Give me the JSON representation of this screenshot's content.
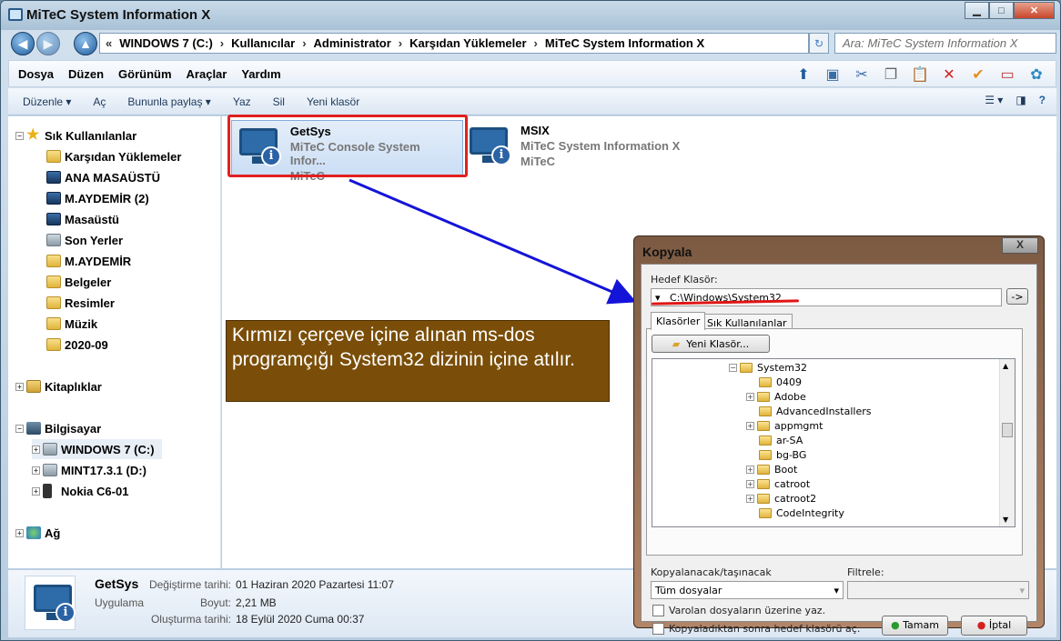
{
  "window": {
    "title": "MiTeC System Information X"
  },
  "address": {
    "crumbs": [
      "WINDOWS 7 (C:)",
      "Kullanıcılar",
      "Administrator",
      "Karşıdan Yüklemeler",
      "MiTeC System Information X"
    ],
    "search_placeholder": "Ara: MiTeC System Information X"
  },
  "menu": [
    "Dosya",
    "Düzen",
    "Görünüm",
    "Araçlar",
    "Yardım"
  ],
  "commands": [
    "Düzenle ▾",
    "Aç",
    "Bununla paylaş ▾",
    "Yaz",
    "Sil",
    "Yeni klasör"
  ],
  "nav": {
    "favorites": "Sık Kullanılanlar",
    "fav_items": [
      "Karşıdan Yüklemeler",
      "ANA MASAÜSTÜ",
      "M.AYDEMİR (2)",
      "Masaüstü",
      "Son Yerler",
      "M.AYDEMİR",
      "Belgeler",
      "Resimler",
      "Müzik",
      "2020-09"
    ],
    "libraries": "Kitaplıklar",
    "computer": "Bilgisayar",
    "drives": [
      "WINDOWS 7 (C:)",
      "MINT17.3.1 (D:)",
      "Nokia C6-01"
    ],
    "network": "Ağ"
  },
  "files": [
    {
      "name": "GetSys",
      "desc": "MiTeC Console System Infor...",
      "company": "MiTeC"
    },
    {
      "name": "MSIX",
      "desc": "MiTeC System Information X",
      "company": "MiTeC"
    }
  ],
  "note": "Kırmızı çerçeve içine alınan ms-dos programçığı System32 dizinin içine atılır.",
  "details": {
    "name": "GetSys",
    "type": "Uygulama",
    "modified_label": "Değiştirme tarihi:",
    "modified": "01 Haziran 2020 Pazartesi 11:07",
    "size_label": "Boyut:",
    "size": "2,21 MB",
    "created_label": "Oluşturma tarihi:",
    "created": "18 Eylül 2020 Cuma 00:37"
  },
  "dialog": {
    "title": "Kopyala",
    "close": "X",
    "target_label": "Hedef Klasör:",
    "target": "C:\\Windows\\System32",
    "go": "->",
    "tabs": [
      "Klasörler",
      "Sık Kullanılanlar"
    ],
    "new_folder": "Yeni Klasör...",
    "tree": [
      "System32",
      "0409",
      "Adobe",
      "AdvancedInstallers",
      "appmgmt",
      "ar-SA",
      "bg-BG",
      "Boot",
      "catroot",
      "catroot2",
      "CodeIntegrity"
    ],
    "copy_label": "Kopyalanacak/taşınacak",
    "copy_value": "Tüm dosyalar",
    "filter_label": "Filtrele:",
    "overwrite": "Varolan dosyaların üzerine yaz.",
    "open_after": "Kopyaladıktan sonra hedef klasörü aç.",
    "ok": "Tamam",
    "cancel": "İptal"
  }
}
